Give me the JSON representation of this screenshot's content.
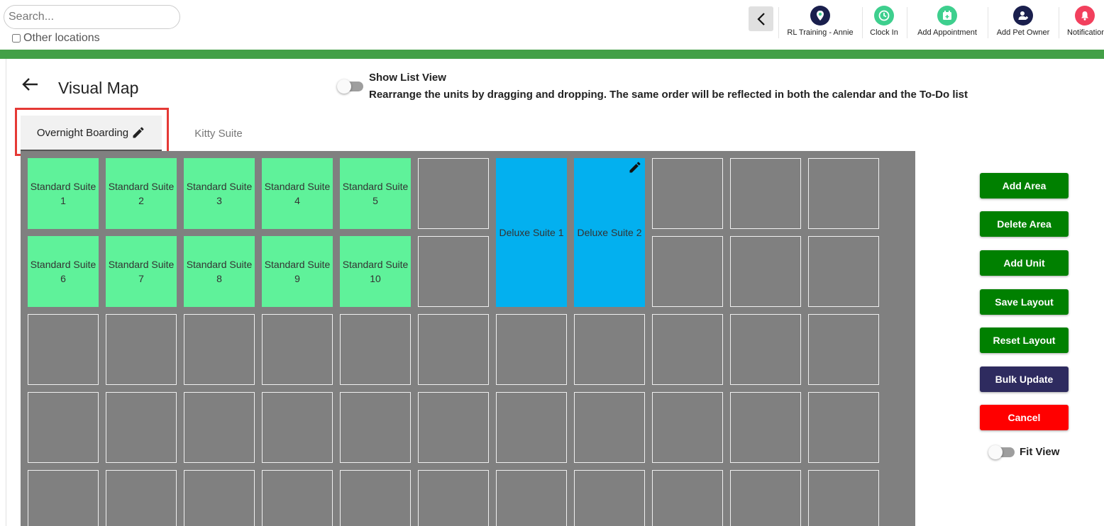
{
  "search": {
    "placeholder": "Search..."
  },
  "other_locations": "Other locations",
  "top_actions": [
    {
      "label": "RL Training - Annie",
      "icon": "location-pin-icon",
      "color": "#1a1f4d"
    },
    {
      "label": "Clock In",
      "icon": "clock-icon",
      "color": "#3ecf8e"
    },
    {
      "label": "Add Appointment",
      "icon": "calendar-add-icon",
      "color": "#3ecf8e"
    },
    {
      "label": "Add Pet Owner",
      "icon": "add-person-icon",
      "color": "#1a1f4d"
    },
    {
      "label": "Notifications",
      "icon": "bell-icon",
      "color": "#f2405d"
    }
  ],
  "page_title": "Visual Map",
  "list_view": {
    "label": "Show List View",
    "hint": "Rearrange the units by dragging and dropping. The same order will be reflected in both the calendar and the To-Do list"
  },
  "tabs": [
    {
      "label": "Overnight Boarding",
      "active": true
    },
    {
      "label": "Kitty Suite",
      "active": false
    }
  ],
  "units": [
    {
      "name": "Standard Suite",
      "number": "1",
      "type": "standard"
    },
    {
      "name": "Standard Suite",
      "number": "2",
      "type": "standard"
    },
    {
      "name": "Standard Suite",
      "number": "3",
      "type": "standard"
    },
    {
      "name": "Standard Suite",
      "number": "4",
      "type": "standard"
    },
    {
      "name": "Standard Suite",
      "number": "5",
      "type": "standard"
    },
    {
      "name": "Standard Suite",
      "number": "6",
      "type": "standard"
    },
    {
      "name": "Standard Suite",
      "number": "7",
      "type": "standard"
    },
    {
      "name": "Standard Suite",
      "number": "8",
      "type": "standard"
    },
    {
      "name": "Standard Suite",
      "number": "9",
      "type": "standard"
    },
    {
      "name": "Standard Suite",
      "number": "10",
      "type": "standard"
    },
    {
      "name": "Deluxe Suite 1",
      "number": "",
      "type": "deluxe"
    },
    {
      "name": "Deluxe Suite 2",
      "number": "",
      "type": "deluxe"
    }
  ],
  "actions": {
    "add_area": "Add Area",
    "delete_area": "Delete Area",
    "add_unit": "Add Unit",
    "save_layout": "Save Layout",
    "reset_layout": "Reset Layout",
    "bulk_update": "Bulk Update",
    "cancel": "Cancel"
  },
  "fit_view": "Fit View",
  "colors": {
    "primary_green": "#008000",
    "bulk_update": "#2e2b5f",
    "cancel": "#ff0000",
    "standard_unit": "#5ff29a",
    "deluxe_unit": "#03b0ef",
    "map_bg": "#808080",
    "header_bar": "#43a047"
  }
}
